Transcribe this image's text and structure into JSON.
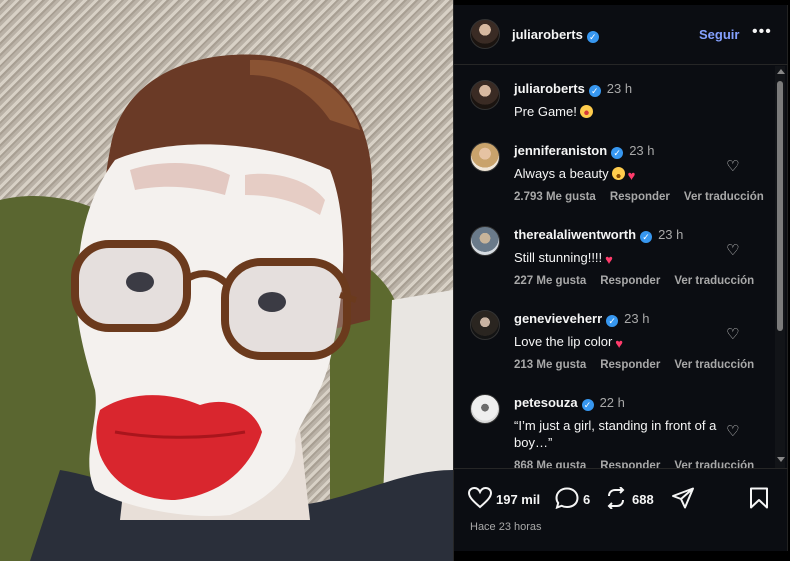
{
  "post": {
    "author": "juliaroberts",
    "follow_label": "Seguir",
    "more_label": "•••",
    "caption_author": "juliaroberts",
    "caption_time": "23 h",
    "caption_text": "Pre Game!",
    "likes": "197 mil",
    "comments_count": "6",
    "reposts": "688",
    "posted_ago": "Hace 23 horas"
  },
  "comments": [
    {
      "user": "jenniferaniston",
      "time": "23 h",
      "text": "Always a beauty",
      "likes": "2.793 Me gusta",
      "reply": "Responder",
      "translate": "Ver traducción"
    },
    {
      "user": "therealaliwentworth",
      "time": "23 h",
      "text": "Still stunning!!!!",
      "likes": "227 Me gusta",
      "reply": "Responder",
      "translate": "Ver traducción"
    },
    {
      "user": "genevieveherr",
      "time": "23 h",
      "text": "Love the lip color",
      "likes": "213 Me gusta",
      "reply": "Responder",
      "translate": "Ver traducción"
    },
    {
      "user": "petesouza",
      "time": "22 h",
      "text": "“I’m just a girl, standing in front of a boy…”",
      "likes": "868 Me gusta",
      "reply": "Responder",
      "translate": "Ver traducción"
    }
  ],
  "colors": {
    "panel_bg": "#0b0d12",
    "follow": "#85a1ff",
    "verified": "#3797f0",
    "heart_emoji": "#ff3b6b"
  },
  "icons": [
    "heart-icon",
    "comment-icon",
    "repost-icon",
    "share-icon",
    "bookmark-icon",
    "verified-icon",
    "more-icon"
  ]
}
